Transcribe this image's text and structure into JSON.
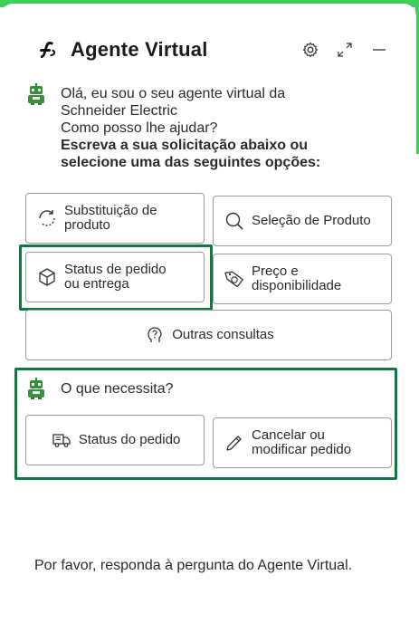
{
  "header": {
    "title": "Agente Virtual",
    "brand_icon": "schneider-logo-icon",
    "settings_icon": "gear-icon",
    "expand_icon": "expand-icon",
    "minimize_icon": "minimize-icon"
  },
  "greeting": {
    "line1": "Olá, eu sou o seu agente virtual da",
    "line2": "Schneider Electric",
    "line3": "Como posso lhe ajudar?",
    "bold1": "Escreva a sua solicitação abaixo ou",
    "bold2": "selecione uma das seguintes opções:"
  },
  "options": [
    {
      "line1": "Substituição de",
      "line2": "produto",
      "icon": "refresh-icon"
    },
    {
      "line1": "Seleção de Produto",
      "icon": "search-icon"
    },
    {
      "line1": "Status de pedido",
      "line2": "ou entrega",
      "icon": "package-icon"
    },
    {
      "line1": "Preço e",
      "line2": "disponibilidade",
      "icon": "price-tag-icon"
    },
    {
      "line1": "Outras consultas",
      "icon": "person-question-icon"
    }
  ],
  "followup": {
    "question": "O que necessita?",
    "options": [
      {
        "label": "Status do pedido",
        "icon": "truck-icon"
      },
      {
        "line1": "Cancelar ou",
        "line2": "modificar pedido",
        "icon": "pencil-icon"
      }
    ]
  },
  "footer": {
    "text": "Por favor, responda à pergunta do Agente Virtual."
  },
  "colors": {
    "brand_green": "#3dcd58",
    "highlight_green": "#0e7a43",
    "border_gray": "#9b9b9b"
  }
}
